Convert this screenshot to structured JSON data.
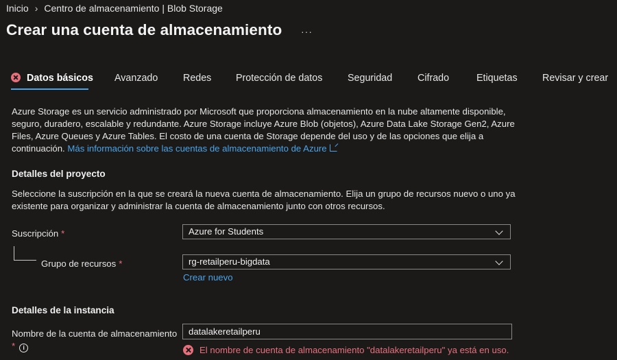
{
  "breadcrumb": {
    "home": "Inicio",
    "current": "Centro de almacenamiento | Blob Storage"
  },
  "page": {
    "title": "Crear una cuenta de almacenamiento",
    "more": "···"
  },
  "tabs": [
    {
      "label": "Datos básicos",
      "active": true,
      "error": true
    },
    {
      "label": "Avanzado"
    },
    {
      "label": "Redes"
    },
    {
      "label": "Protección de datos"
    },
    {
      "label": "Seguridad"
    },
    {
      "label": "Cifrado"
    },
    {
      "label": "Etiquetas"
    },
    {
      "label": "Revisar y crear"
    }
  ],
  "intro": {
    "text": "Azure Storage es un servicio administrado por Microsoft que proporciona almacenamiento en la nube altamente disponible, seguro, duradero, escalable y redundante. Azure Storage incluye Azure Blob (objetos), Azure Data Lake Storage Gen2, Azure Files, Azure Queues y Azure Tables. El costo de una cuenta de Storage depende del uso y de las opciones que elija a continuación.",
    "link": "Más información sobre las cuentas de almacenamiento de Azure"
  },
  "project": {
    "heading": "Detalles del proyecto",
    "description": "Seleccione la suscripción en la que se creará la nueva cuenta de almacenamiento. Elija un grupo de recursos nuevo o uno ya existente para organizar y administrar la cuenta de almacenamiento junto con otros recursos.",
    "subscription_label": "Suscripción",
    "subscription_value": "Azure for Students",
    "resource_group_label": "Grupo de recursos",
    "resource_group_value": "rg-retailperu-bigdata",
    "create_new": "Crear nuevo",
    "required_mark": "*"
  },
  "instance": {
    "heading": "Detalles de la instancia",
    "name_label": "Nombre de la cuenta de almacenamiento",
    "name_value": "datalakeretailperu",
    "required_mark": "*",
    "info_glyph": "i",
    "error": "El nombre de cuenta de almacenamiento \"datalakeretailperu\" ya está en uso."
  },
  "colors": {
    "background": "#1b1a19",
    "accent": "#4aa4e8",
    "error": "#e8707c"
  }
}
